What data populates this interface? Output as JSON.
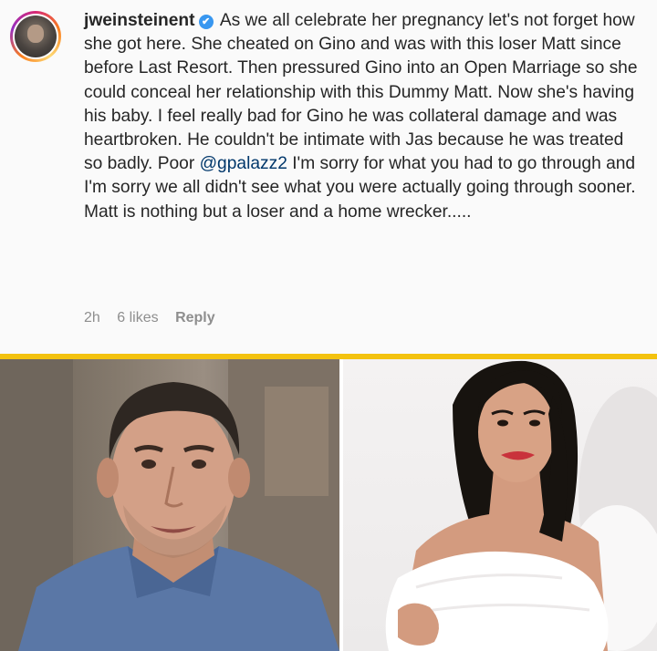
{
  "comment": {
    "username": "jweinsteinent",
    "verified_badge": "✔",
    "text_part1": "As we all celebrate her pregnancy let's not forget how she got here. She cheated on Gino and was with this loser Matt since before Last Resort. Then pressured Gino into an Open Marriage so she could conceal her relationship with this Dummy Matt. Now she's having his baby. I feel really bad for Gino he was collateral damage and was heartbroken. He couldn't be intimate with Jas because he was treated so badly. Poor ",
    "mention": "@gpalazz2",
    "text_part2": " I'm sorry for what you had to go through and I'm sorry we all didn't see what you were actually going through sooner. Matt is nothing but a loser and a home wrecker.....",
    "time": "2h",
    "likes": "6 likes",
    "reply_label": "Reply"
  },
  "colors": {
    "divider": "#f3c20f",
    "mention": "#00376b",
    "meta": "#8e8e8e"
  },
  "icons": [
    "verified-badge-icon"
  ]
}
